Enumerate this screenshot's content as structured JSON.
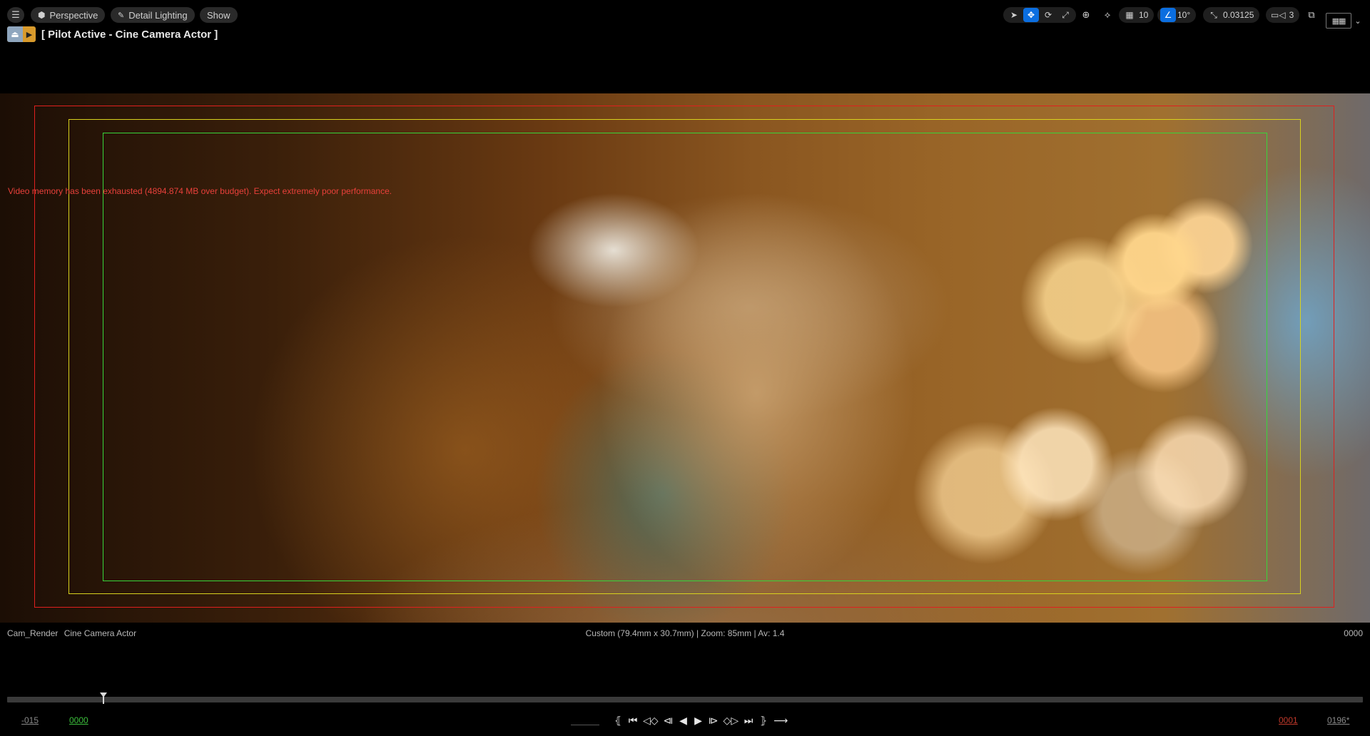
{
  "toolbar": {
    "menu_icon": "hamburger-menu-icon",
    "view_mode_label": "Perspective",
    "lighting_label": "Detail Lighting",
    "show_label": "Show",
    "grid_snap_value": "10",
    "rotation_snap_value": "10°",
    "scale_snap_value": "0.03125",
    "camera_speed_value": "3"
  },
  "pilot": {
    "title": "[ Pilot Active - Cine Camera Actor ]"
  },
  "viewport": {
    "warning": "Video memory has been exhausted (4894.874 MB over budget). Expect extremely poor performance.",
    "colors": {
      "action_safe": "#e0201e",
      "title_safe": "#d8d21e",
      "inner_safe": "#38d43a"
    }
  },
  "info": {
    "camera_name": "Cam_Render",
    "camera_type": "Cine Camera Actor",
    "lens_info": "Custom (79.4mm x 30.7mm) | Zoom: 85mm | Av: 1.4",
    "frame_counter": "0000"
  },
  "timeline": {
    "start_frame": "-015",
    "current_frame": "0000",
    "end_frame": "0001",
    "total_frames": "0196*"
  }
}
